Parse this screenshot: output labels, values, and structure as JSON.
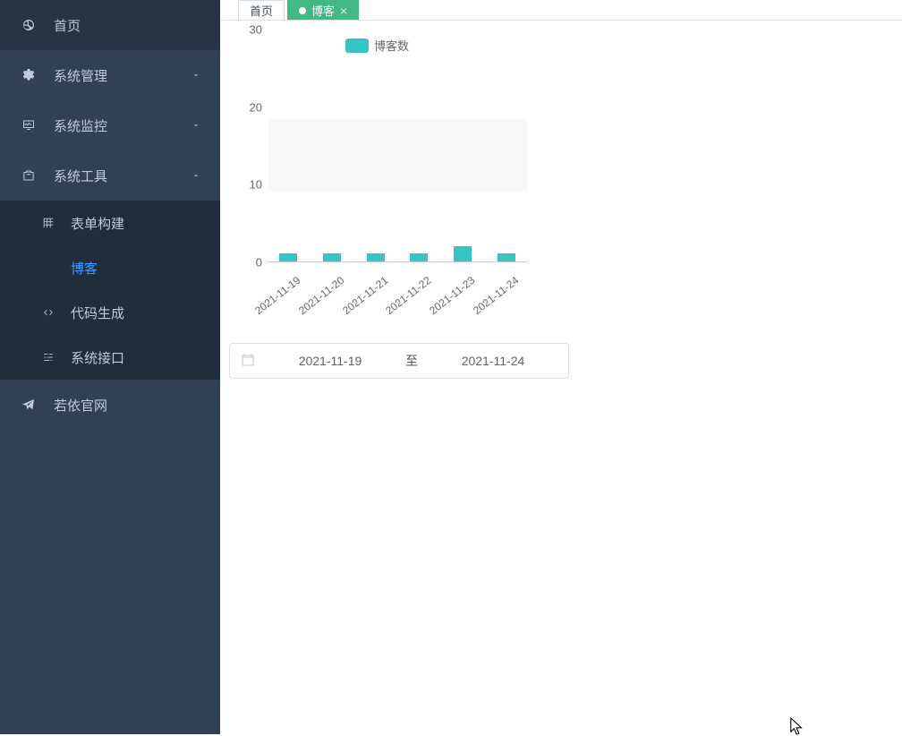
{
  "sidebar": {
    "items": [
      {
        "label": "首页",
        "icon": "dashboard"
      },
      {
        "label": "系统管理",
        "icon": "gear",
        "expandable": true,
        "expanded": false
      },
      {
        "label": "系统监控",
        "icon": "monitor",
        "expandable": true,
        "expanded": false
      },
      {
        "label": "系统工具",
        "icon": "tools",
        "expandable": true,
        "expanded": true,
        "children": [
          {
            "label": "表单构建",
            "icon": "grid"
          },
          {
            "label": "博客",
            "icon": "blank",
            "active": true
          },
          {
            "label": "代码生成",
            "icon": "code"
          },
          {
            "label": "系统接口",
            "icon": "sliders"
          }
        ]
      },
      {
        "label": "若依官网",
        "icon": "paper-plane"
      }
    ]
  },
  "tabs": [
    {
      "label": "首页",
      "active": false,
      "closable": false
    },
    {
      "label": "博客",
      "active": true,
      "closable": true
    }
  ],
  "chart_data": {
    "type": "bar",
    "categories": [
      "2021-11-19",
      "2021-11-20",
      "2021-11-21",
      "2021-11-22",
      "2021-11-23",
      "2021-11-24"
    ],
    "values": [
      1,
      1,
      1,
      1,
      2,
      1
    ],
    "legend": "博客数",
    "ylim": [
      0,
      30
    ],
    "yticks": [
      0,
      10,
      20,
      30
    ]
  },
  "date_range": {
    "start": "2021-11-19",
    "separator": "至",
    "end": "2021-11-24"
  }
}
